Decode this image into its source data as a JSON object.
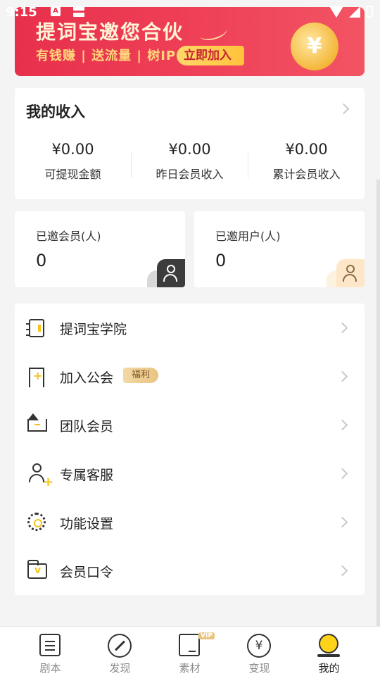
{
  "status_bar": {
    "time": "9:15",
    "notification_icons": [
      "text-a-icon",
      "storage-icon"
    ],
    "system_icons": [
      "wifi-icon",
      "signal-icon",
      "battery-icon"
    ]
  },
  "banner": {
    "title": "提词宝邀您合伙",
    "subtitle": "有钱赚 | 送流量 | 树IP",
    "cta": "立即加入",
    "coin_symbol": "¥",
    "colors": {
      "background": "#e8304c",
      "subtitle": "#ffd77a",
      "cta_bg": "#ffc23a"
    }
  },
  "income": {
    "title": "我的收入",
    "stats": [
      {
        "amount": "¥0.00",
        "label": "可提现金额"
      },
      {
        "amount": "¥0.00",
        "label": "昨日会员收入"
      },
      {
        "amount": "¥0.00",
        "label": "累计会员收入"
      }
    ]
  },
  "invites": {
    "members": {
      "label": "已邀会员(人)",
      "count": "0",
      "icon": "add-member-icon"
    },
    "users": {
      "label": "已邀用户(人)",
      "count": "0",
      "icon": "user-icon"
    }
  },
  "menu": {
    "items": [
      {
        "label": "提词宝学院",
        "icon": "book-icon"
      },
      {
        "label": "加入公会",
        "icon": "bookmark-plus-icon",
        "tag": "福利"
      },
      {
        "label": "团队会员",
        "icon": "crown-icon"
      },
      {
        "label": "专属客服",
        "icon": "user-plus-icon"
      },
      {
        "label": "功能设置",
        "icon": "gear-icon"
      },
      {
        "label": "会员口令",
        "icon": "folder-v-icon"
      }
    ]
  },
  "bottom_nav": {
    "items": [
      {
        "label": "剧本",
        "icon": "script-icon"
      },
      {
        "label": "发现",
        "icon": "compass-icon"
      },
      {
        "label": "素材",
        "icon": "material-icon",
        "badge": "VIP"
      },
      {
        "label": "变现",
        "icon": "yuan-icon",
        "symbol": "¥"
      },
      {
        "label": "我的",
        "icon": "profile-icon",
        "active": true
      }
    ]
  },
  "accent_color": "#f7c31a"
}
